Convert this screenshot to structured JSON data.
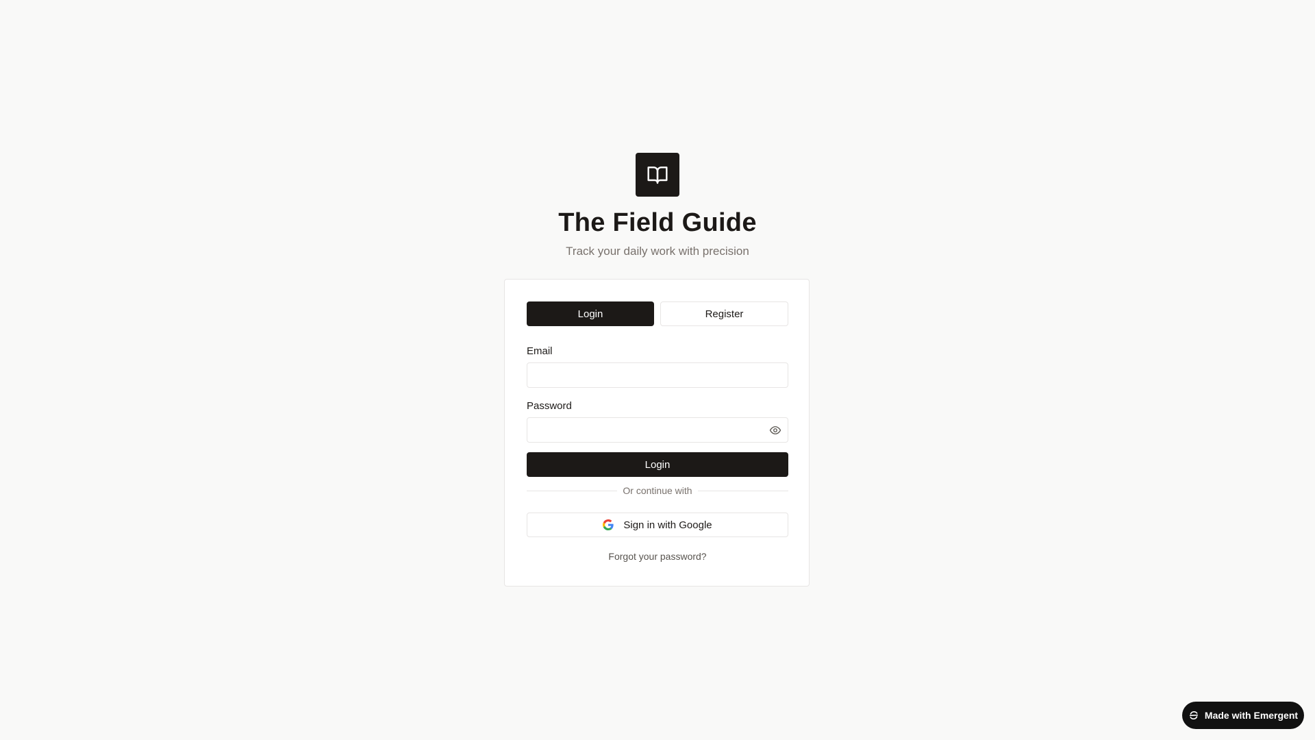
{
  "brand": {
    "logo_icon": "book-open-icon",
    "title": "The Field Guide",
    "subtitle": "Track your daily work with precision"
  },
  "tabs": {
    "login": "Login",
    "register": "Register",
    "active": "login"
  },
  "form": {
    "email_label": "Email",
    "email_value": "",
    "password_label": "Password",
    "password_value": "",
    "password_toggle_icon": "eye-icon",
    "submit_label": "Login",
    "divider_text": "Or continue with",
    "google_label": "Sign in with Google",
    "google_icon": "google-icon",
    "forgot_label": "Forgot your password?"
  },
  "badge": {
    "label": "Made with Emergent",
    "icon": "emergent-logo-icon"
  },
  "colors": {
    "background": "#f9f9f8",
    "primary": "#1c1917",
    "border": "#e7e5e4",
    "muted_text": "#78716c"
  }
}
